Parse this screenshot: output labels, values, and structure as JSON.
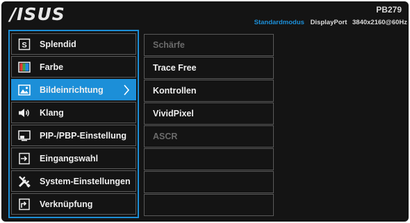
{
  "header": {
    "logo": "/ISUS",
    "model": "PB279",
    "mode": "Standardmodus",
    "input": "DisplayPort",
    "resolution": "3840x2160@60Hz"
  },
  "menu": {
    "items": [
      {
        "label": "Splendid",
        "icon": "splendid-s-icon"
      },
      {
        "label": "Farbe",
        "icon": "color-bars-icon"
      },
      {
        "label": "Bildeinrichtung",
        "icon": "image-icon",
        "active": true
      },
      {
        "label": "Klang",
        "icon": "speaker-icon"
      },
      {
        "label": "PIP-/PBP-Einstellung",
        "icon": "pip-icon"
      },
      {
        "label": "Eingangswahl",
        "icon": "input-icon"
      },
      {
        "label": "System-Einstellungen",
        "icon": "tools-icon"
      },
      {
        "label": "Verknüpfung",
        "icon": "shortcut-icon"
      }
    ]
  },
  "submenu": {
    "items": [
      {
        "label": "Schärfe",
        "enabled": false
      },
      {
        "label": "Trace Free",
        "enabled": true
      },
      {
        "label": "Kontrollen",
        "enabled": true
      },
      {
        "label": "VividPixel",
        "enabled": true
      },
      {
        "label": "ASCR",
        "enabled": false
      },
      {
        "label": "",
        "enabled": false
      },
      {
        "label": "",
        "enabled": false
      },
      {
        "label": "",
        "enabled": false
      }
    ]
  },
  "colors": {
    "accent": "#1c8fd8",
    "background": "#141414",
    "disabled_text": "#6b6b6b"
  }
}
